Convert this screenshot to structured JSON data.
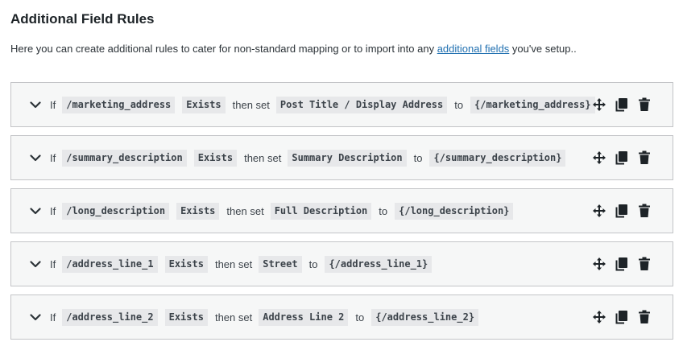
{
  "title": "Additional Field Rules",
  "intro": {
    "before": "Here you can create additional rules to cater for non-standard mapping or to import into any ",
    "link": "additional fields",
    "after": " you've setup.."
  },
  "labels": {
    "if": "If",
    "then_set": "then set",
    "to": "to"
  },
  "icons": {
    "expand": "chevron-down-icon",
    "move": "move-arrows-icon",
    "duplicate": "copy-icon",
    "delete": "trash-icon"
  },
  "rules": [
    {
      "field": "/marketing_address",
      "operator": "Exists",
      "target": "Post Title / Display Address",
      "value": "{/marketing_address}"
    },
    {
      "field": "/summary_description",
      "operator": "Exists",
      "target": "Summary Description",
      "value": "{/summary_description}"
    },
    {
      "field": "/long_description",
      "operator": "Exists",
      "target": "Full Description",
      "value": "{/long_description}"
    },
    {
      "field": "/address_line_1",
      "operator": "Exists",
      "target": "Street",
      "value": "{/address_line_1}"
    },
    {
      "field": "/address_line_2",
      "operator": "Exists",
      "target": "Address Line 2",
      "value": "{/address_line_2}"
    }
  ]
}
